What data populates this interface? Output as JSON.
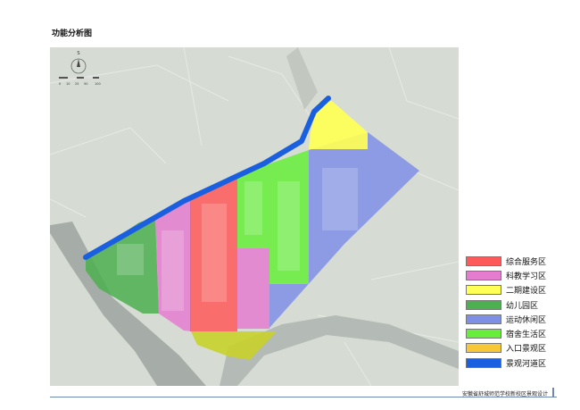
{
  "page": {
    "title": "功能分析图",
    "footer": "安徽省舒城师范学校新校区景观设计"
  },
  "compass": {
    "north_letter": "S",
    "scale_ticks": [
      "0",
      "10",
      "25",
      "50",
      "100"
    ]
  },
  "legend": [
    {
      "label": "综合服务区",
      "color": "#ff5a5a"
    },
    {
      "label": "科教学习区",
      "color": "#e57ccf"
    },
    {
      "label": "二期建设区",
      "color": "#ffff55"
    },
    {
      "label": "幼儿园区",
      "color": "#4caf50"
    },
    {
      "label": "运动休闲区",
      "color": "#7f8fe6"
    },
    {
      "label": "宿舍生活区",
      "color": "#66ee3a"
    },
    {
      "label": "入口景观区",
      "color": "#f7c737"
    },
    {
      "label": "景观河道区",
      "color": "#1a5fe0"
    }
  ],
  "map": {
    "base_color": "#d6dcd4",
    "road_color": "#a6aca8",
    "zones": [
      {
        "id": "zone-kindergarten",
        "zone": "幼儿园区",
        "color": "#4caf50"
      },
      {
        "id": "zone-science",
        "zone": "科教学习区",
        "color": "#e57ccf"
      },
      {
        "id": "zone-science-east",
        "zone": "科教学习区",
        "color": "#e57ccf"
      },
      {
        "id": "zone-service",
        "zone": "综合服务区",
        "color": "#ff5a5a"
      },
      {
        "id": "zone-dorm",
        "zone": "宿舍生活区",
        "color": "#66ee3a"
      },
      {
        "id": "zone-sports",
        "zone": "运动休闲区",
        "color": "#7f8fe6"
      },
      {
        "id": "zone-phase2",
        "zone": "二期建设区",
        "color": "#ffff55"
      },
      {
        "id": "zone-entrance",
        "zone": "入口景观区",
        "color": "#c8d22a"
      },
      {
        "id": "zone-river",
        "zone": "景观河道区",
        "color": "#1a5fe0"
      }
    ]
  }
}
